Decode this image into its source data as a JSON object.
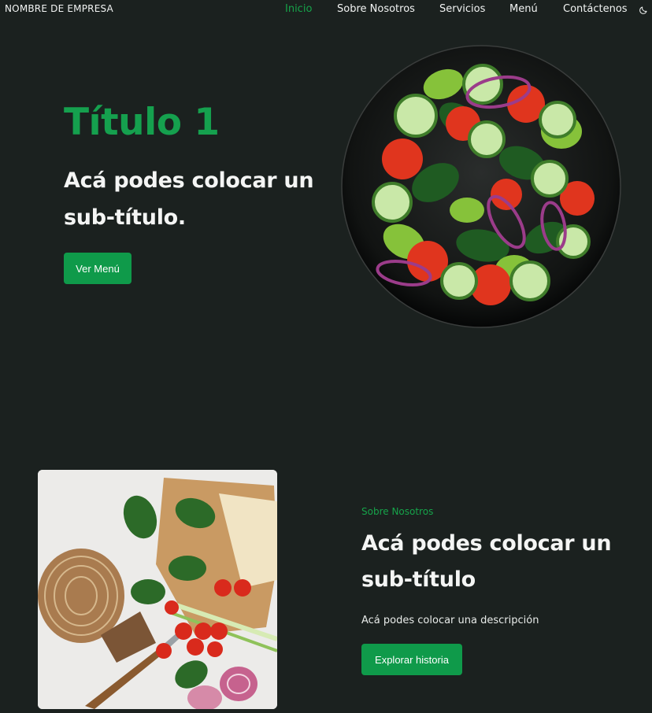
{
  "navbar": {
    "brand": "NOMBRE DE EMPRESA",
    "links": [
      {
        "label": "Inicio",
        "active": true
      },
      {
        "label": "Sobre Nosotros",
        "active": false
      },
      {
        "label": "Servicios",
        "active": false
      },
      {
        "label": "Menú",
        "active": false
      },
      {
        "label": "Contáctenos",
        "active": false
      }
    ],
    "theme_icon": "moon-icon"
  },
  "hero": {
    "title": "Título 1",
    "subtitle": "Acá podes colocar un sub-título.",
    "button_label": "Ver Menú",
    "image": "salad-bowl-image"
  },
  "about": {
    "kicker": "Sobre Nosotros",
    "title": "Acá podes colocar un sub-título",
    "description": "Acá podes colocar una descripción",
    "button_label": "Explorar historia",
    "image": "ingredients-image"
  },
  "colors": {
    "background": "#1b211f",
    "accent": "#16a34a",
    "button": "#0f9a4a",
    "text": "#f2f4f3"
  }
}
